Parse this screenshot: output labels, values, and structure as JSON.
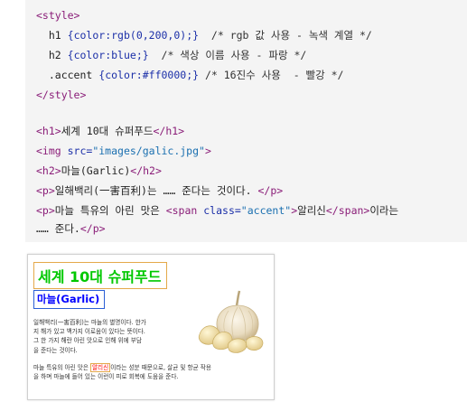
{
  "code": {
    "style_open": "<style>",
    "css_h1_selector": "h1",
    "css_h1_decl": "{color:rgb(0,200,0);}",
    "css_h1_comment": "/* rgb 값 사용 - 녹색 계열 */",
    "css_h2_selector": "h2",
    "css_h2_decl": "{color:blue;}",
    "css_h2_comment": "/* 색상 이름 사용 - 파랑 */",
    "css_accent_selector": ".accent",
    "css_accent_decl": "{color:#ff0000;}",
    "css_accent_comment": "/* 16진수 사용  - 빨강 */",
    "style_close": "</style>",
    "h1_open": "<h1>",
    "h1_text": "세계 10대 슈퍼푸드",
    "h1_close": "</h1>",
    "img_open": "<img ",
    "img_attr": "src=",
    "img_value": "\"images/galic.jpg\"",
    "img_close": ">",
    "h2_open": "<h2>",
    "h2_text": "마늘(Garlic)",
    "h2_close": "</h2>",
    "p1_open": "<p>",
    "p1_text": "일해백리(一害百利)는 …… 준다는 것이다. ",
    "p1_close": "</p>",
    "p2_open": "<p>",
    "p2_text_a": "마늘 특유의 아린 맛은 ",
    "span_open": "<span ",
    "span_attr": "class=",
    "span_value": "\"accent\"",
    "span_gt": ">",
    "span_text": "알리신",
    "span_close": "</span>",
    "p2_text_b": "이라는",
    "p2_line2_text": "…… 준다.",
    "p2_close": "</p>"
  },
  "preview": {
    "h1": "세계 10대 슈퍼푸드",
    "h2": "마늘(Garlic)",
    "p1_lines": [
      "일해백리(一害百利)는 마늘의 별명이다. 한가",
      "지 해가 있고 백가지 이로움이 있다는 뜻이다.",
      "그 한 가지 해란 아린 맛으로 인해 위에 부담",
      "을 준다는 것이다."
    ],
    "p2_line1_a": "마늘 특유의 아린 맛은 ",
    "p2_line1_accent": "알리신",
    "p2_line1_b": "이라는 성분 때문으로, 살균 및 항균 작용",
    "p2_line2": "을 하며 마늘에 들어 있는 이런이 피로 회복에 도움을 준다."
  },
  "colors": {
    "h1": "#00c800",
    "h2": "#0000ff",
    "accent": "#ff0000",
    "code_bg": "#f4f4f4"
  },
  "image_subject": "garlic-image"
}
